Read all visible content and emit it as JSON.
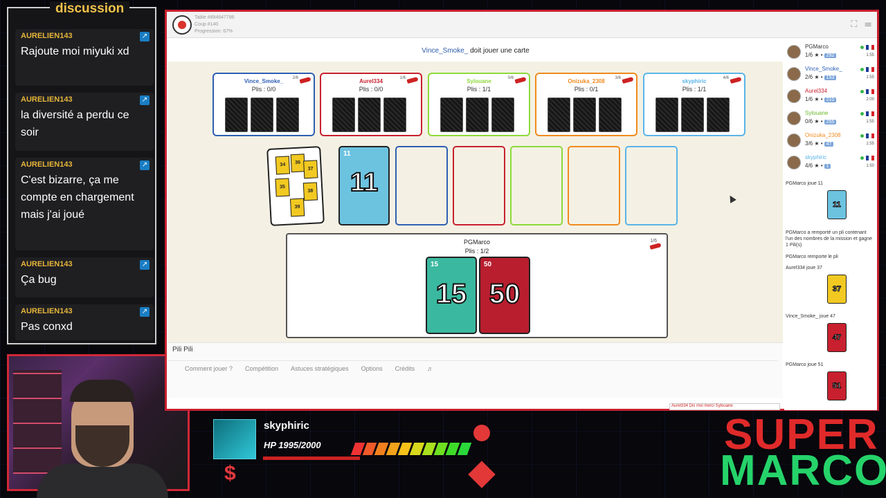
{
  "chat": {
    "title": "discussion",
    "messages": [
      {
        "user": "AURELIEN143",
        "text": "Rajoute moi miyuki xd"
      },
      {
        "user": "AURELIEN143",
        "text": "la diversité a perdu ce soir"
      },
      {
        "user": "AURELIEN143",
        "text": "C'est bizarre, ça me compte en chargement mais j'ai joué"
      },
      {
        "user": "AURELIEN143",
        "text": "Ça bug"
      },
      {
        "user": "AURELIEN143",
        "text": "Pas conxd"
      }
    ]
  },
  "game": {
    "table_info": [
      "Table #894647786",
      "Coup #140",
      "Progression: 67%"
    ],
    "status_player": "Vince_Smoke_",
    "status_text": "doit jouer une carte",
    "players": [
      {
        "name": "Vince_Smoke_",
        "plis": "Plis : 0/0",
        "count": "2/6",
        "color": "#2e5fb3"
      },
      {
        "name": "Aurel334",
        "plis": "Plis : 0/0",
        "count": "1/6",
        "color": "#c8202e"
      },
      {
        "name": "Sylouane",
        "plis": "Plis : 1/1",
        "count": "0/6",
        "color": "#8ed93a"
      },
      {
        "name": "Onizuka_2308",
        "plis": "Plis : 0/1",
        "count": "3/6",
        "color": "#f08a1e"
      },
      {
        "name": "skyphiric",
        "plis": "Plis : 1/1",
        "count": "4/6",
        "color": "#5ab4e8"
      }
    ],
    "deck_values": [
      "34",
      "36",
      "37",
      "35",
      "38",
      "39"
    ],
    "played_card": {
      "value": "11",
      "color": "#6cc3e0"
    },
    "slot_colors": [
      "#2e5fb3",
      "#c8202e",
      "#8ed93a",
      "#f08a1e",
      "#5ab4e8"
    ],
    "hand": {
      "name": "PGMarco",
      "plis": "Plis : 1/2",
      "count": "1/6",
      "cards": [
        {
          "value": "15",
          "color": "#3bb9a0"
        },
        {
          "value": "50",
          "color": "#b81e2e"
        }
      ]
    },
    "footer_title": "Pili Pili",
    "links": [
      "Comment jouer ?",
      "Compétition",
      "Astuces stratégiques",
      "Options",
      "Crédits",
      "♬"
    ],
    "chat_input": "Aurel334 Dis moi merci Sylouane"
  },
  "sidebar": {
    "players": [
      {
        "name": "PGMarco",
        "score": "1/6",
        "elo": "292",
        "time": "1:55",
        "name_color": "#333"
      },
      {
        "name": "Vince_Smoke_",
        "score": "2/6",
        "elo": "153",
        "time": "1:55",
        "name_color": "#2e5fb3"
      },
      {
        "name": "Aurel334",
        "score": "1/6",
        "elo": "210",
        "time": "2:00",
        "name_color": "#c8202e"
      },
      {
        "name": "Sylouane",
        "score": "0/6",
        "elo": "255",
        "time": "1:55",
        "name_color": "#6ab82a"
      },
      {
        "name": "Onizuka_2308",
        "score": "3/6",
        "elo": "47",
        "time": "1:55",
        "name_color": "#f08a1e"
      },
      {
        "name": "skyphiric",
        "score": "4/6",
        "elo": "1",
        "time": "1:50",
        "name_color": "#5ab4e8"
      }
    ],
    "log": [
      {
        "text": "PGMarco joue 11",
        "card": "11",
        "card_color": "#6cc3e0"
      },
      {
        "text": "PGMarco a remporté un pli contenant l'un des nombres de la mission et gagne 1 Pili(s)"
      },
      {
        "text": "PGMarco remporte le pli"
      },
      {
        "text": "Aurel334 joue 37",
        "card": "37",
        "card_color": "#f2c921"
      },
      {
        "text": "Vince_Smoke_ joue 47",
        "card": "47",
        "card_color": "#c8202e"
      },
      {
        "text": "PGMarco joue 51",
        "card": "51",
        "card_color": "#c8202e"
      }
    ]
  },
  "hud": {
    "name": "skyphiric",
    "hp": "HP 1995/2000",
    "currency": "$",
    "bar_colors": [
      "#e33",
      "#f05a2a",
      "#f2801e",
      "#f4a21a",
      "#f6c21a",
      "#d8d81c",
      "#a8e01e",
      "#6ee020",
      "#3edc28",
      "#2ad83a"
    ],
    "logo_top": "SUPER",
    "logo_bottom": "MARCO"
  }
}
